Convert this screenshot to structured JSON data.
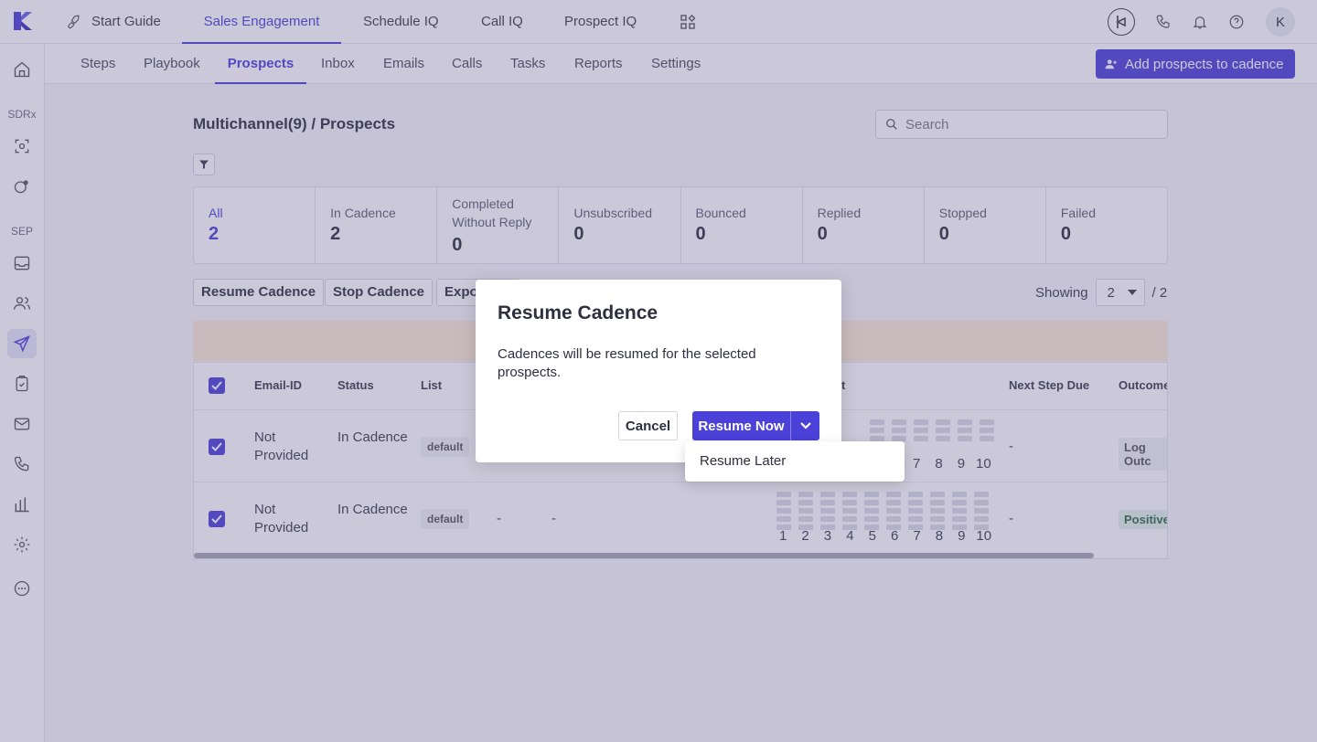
{
  "app_tabs": [
    {
      "label": "Start Guide"
    },
    {
      "label": "Sales Engagement"
    },
    {
      "label": "Schedule IQ"
    },
    {
      "label": "Call IQ"
    },
    {
      "label": "Prospect IQ"
    }
  ],
  "avatar_initial": "K",
  "sidebar": {
    "section_sdrx": "SDRx",
    "section_sep": "SEP"
  },
  "subnav": [
    "Steps",
    "Playbook",
    "Prospects",
    "Inbox",
    "Emails",
    "Calls",
    "Tasks",
    "Reports",
    "Settings"
  ],
  "add_button_label": "Add prospects to cadence",
  "breadcrumb": "Multichannel(9) / Prospects",
  "search": {
    "placeholder": "Search"
  },
  "stats": [
    {
      "label": "All",
      "value": "2"
    },
    {
      "label": "In Cadence",
      "value": "2"
    },
    {
      "label": "Completed Without Reply",
      "value": "0"
    },
    {
      "label": "Unsubscribed",
      "value": "0"
    },
    {
      "label": "Bounced",
      "value": "0"
    },
    {
      "label": "Replied",
      "value": "0"
    },
    {
      "label": "Stopped",
      "value": "0"
    },
    {
      "label": "Failed",
      "value": "0"
    }
  ],
  "actions": {
    "resume": "Resume Cadence",
    "stop": "Stop Cadence",
    "export": "Expo"
  },
  "showing": {
    "label": "Showing",
    "value": "2",
    "total": "/ 2"
  },
  "table": {
    "headers": {
      "email": "Email-ID",
      "status": "Status",
      "list": "List",
      "step": "t",
      "next_due": "Next Step Due",
      "outcome": "Outcome"
    },
    "rows": [
      {
        "email": "Not Provided",
        "status": "In Cadence",
        "list": "default",
        "col4": "",
        "col5": "",
        "next_due": "-",
        "outcome": "Log Outc"
      },
      {
        "email": "Not Provided",
        "status": "In Cadence",
        "list": "default",
        "col4": "-",
        "col5": "-",
        "next_due": "-",
        "outcome": "Positive"
      }
    ],
    "step_numbers": [
      "1",
      "2",
      "3",
      "4",
      "5",
      "6",
      "7",
      "8",
      "9",
      "10"
    ],
    "row1_step_numbers": [
      "7",
      "8",
      "9",
      "10"
    ]
  },
  "modal": {
    "title": "Resume Cadence",
    "body": "Cadences will be resumed for the selected prospects.",
    "cancel": "Cancel",
    "resume_now": "Resume Now",
    "dropdown_option": "Resume Later"
  },
  "colors": {
    "accent": "#4b40d8",
    "banner": "#fce9d6",
    "positive": "#e3f4ea"
  }
}
